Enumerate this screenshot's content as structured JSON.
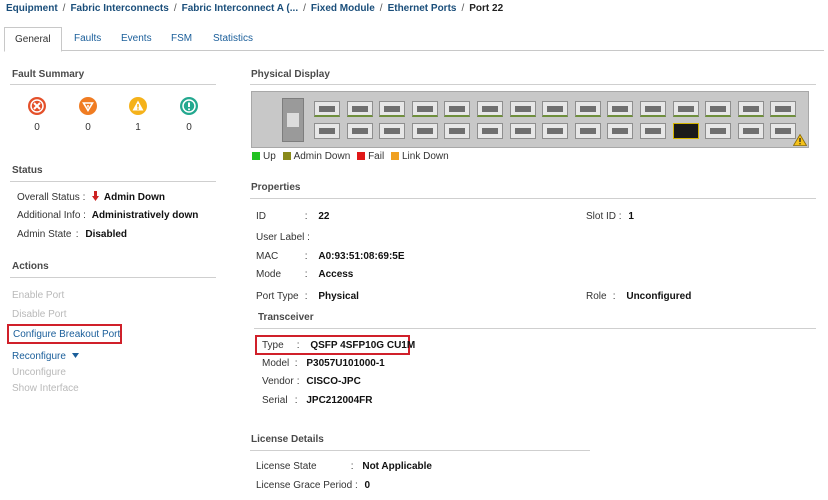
{
  "breadcrumb": {
    "items": [
      "Equipment",
      "Fabric Interconnects",
      "Fabric Interconnect A (...",
      "Fixed Module",
      "Ethernet Ports",
      "Port 22"
    ],
    "separator": "/"
  },
  "tabs": [
    "General",
    "Faults",
    "Events",
    "FSM",
    "Statistics"
  ],
  "active_tab": "General",
  "fault_summary": {
    "title": "Fault Summary",
    "items": [
      {
        "severity": "critical",
        "icon": "critical-x-icon",
        "color": "#e4502a",
        "count": "0"
      },
      {
        "severity": "major",
        "icon": "major-down-icon",
        "color": "#f07c22",
        "count": "0"
      },
      {
        "severity": "minor",
        "icon": "minor-warning-icon",
        "color": "#f5b21a",
        "count": "1"
      },
      {
        "severity": "warning",
        "icon": "warning-info-icon",
        "color": "#23a88f",
        "count": "0"
      }
    ]
  },
  "status": {
    "title": "Status",
    "overall_status_label": "Overall Status :",
    "overall_status_value": "Admin Down",
    "additional_info_label": "Additional Info :",
    "additional_info_value": "Administratively down",
    "admin_state_label": "Admin State",
    "admin_state_sep": ":",
    "admin_state_value": "Disabled"
  },
  "actions": {
    "title": "Actions",
    "enable_port": "Enable Port",
    "disable_port": "Disable Port",
    "configure_breakout_port": "Configure Breakout Port",
    "reconfigure": "Reconfigure",
    "unconfigure": "Unconfigure",
    "show_interface": "Show Interface"
  },
  "physical_display": {
    "title": "Physical Display",
    "legend": [
      {
        "label": "Up",
        "color": "#22c222"
      },
      {
        "label": "Admin Down",
        "color": "#8a8a1a"
      },
      {
        "label": "Fail",
        "color": "#e01818"
      },
      {
        "label": "Link Down",
        "color": "#f0a020"
      }
    ]
  },
  "properties": {
    "title": "Properties",
    "id_label": "ID",
    "id_value": "22",
    "slot_id_label": "Slot ID :",
    "slot_id_value": "1",
    "user_label_label": "User Label :",
    "mac_label": "MAC",
    "mac_value": "A0:93:51:08:69:5E",
    "mode_label": "Mode",
    "mode_value": "Access",
    "port_type_label": "Port Type",
    "port_type_sep": ":",
    "port_type_value": "Physical",
    "role_label": "Role",
    "role_sep": ":",
    "role_value": "Unconfigured",
    "sep": ":"
  },
  "transceiver": {
    "title": "Transceiver",
    "type_label": "Type",
    "type_value": "QSFP 4SFP10G CU1M",
    "model_label": "Model",
    "model_value": "P3057U101000-1",
    "vendor_label": "Vendor",
    "vendor_value": "CISCO-JPC",
    "serial_label": "Serial",
    "serial_value": "JPC212004FR",
    "sep": ":"
  },
  "license_details": {
    "title": "License Details",
    "license_state_label": "License State",
    "license_state_value": "Not Applicable",
    "grace_period_label": "License Grace Period :",
    "grace_period_value": "0",
    "sep": ":"
  },
  "colors": {
    "link": "#1a5e9a",
    "highlight": "#d0202a",
    "disabled": "#b9b9b9",
    "admin_down_arrow": "#cc2222"
  }
}
